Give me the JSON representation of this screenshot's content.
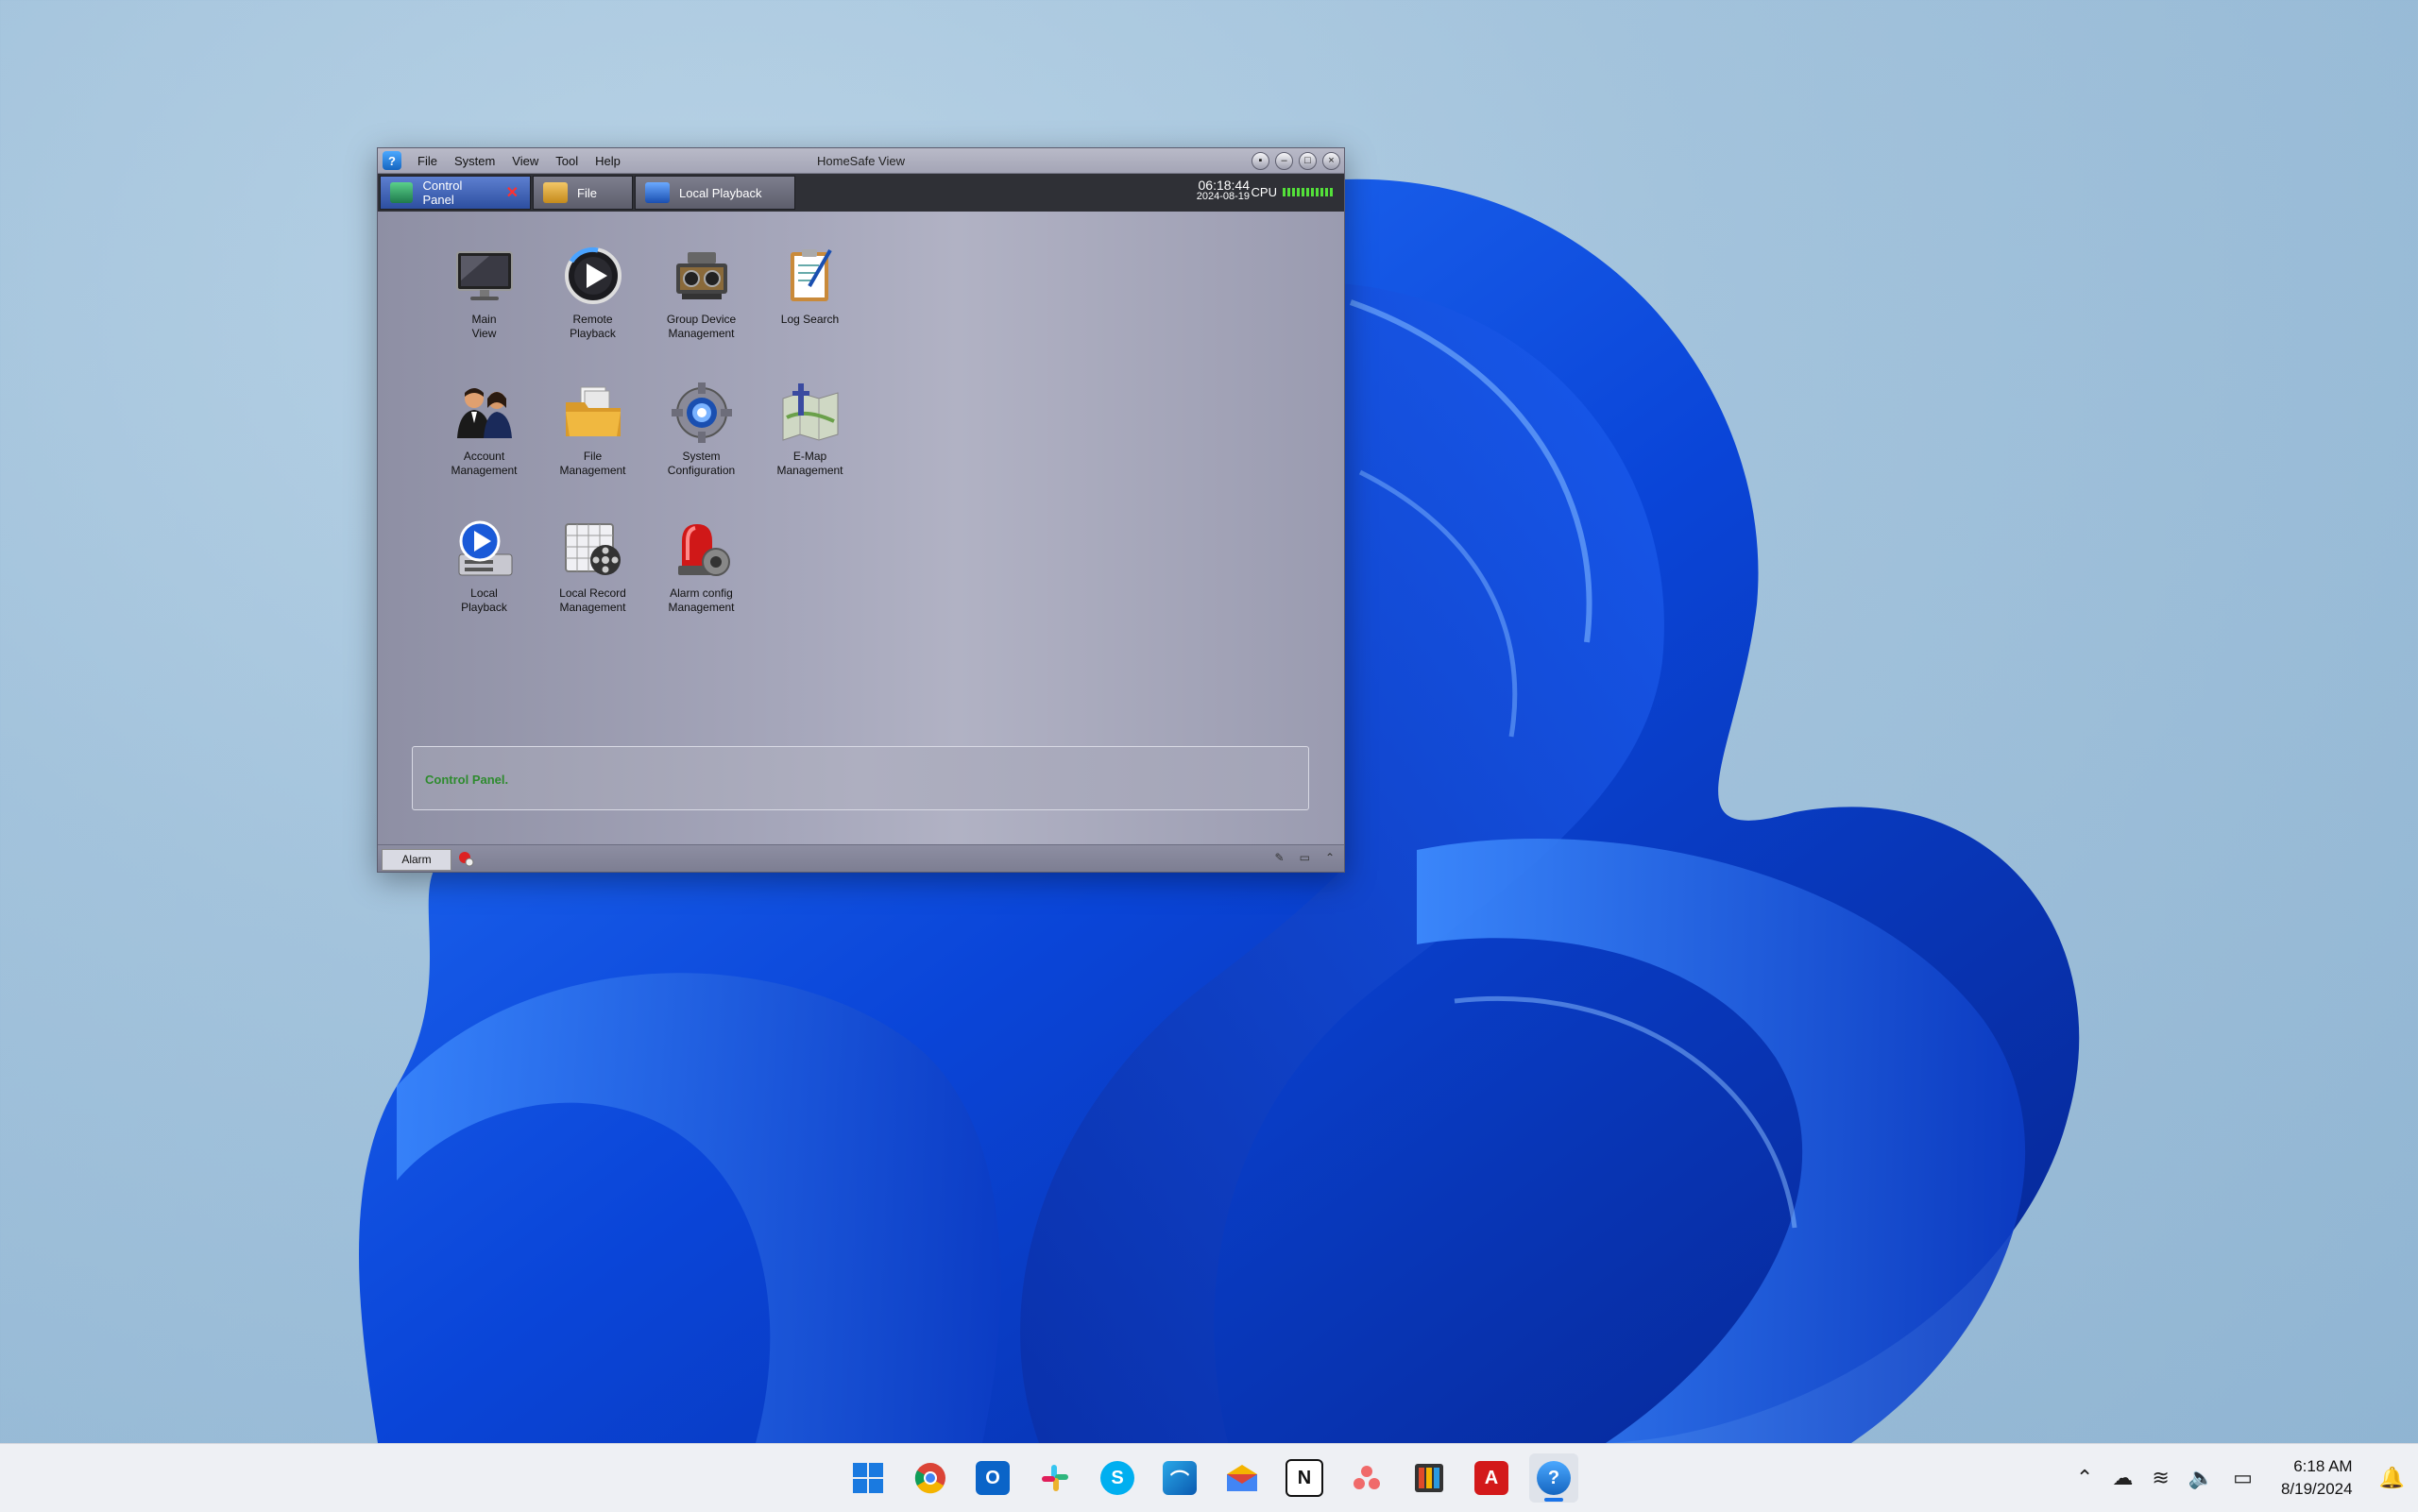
{
  "window": {
    "title": "HomeSafe View",
    "menu": [
      "File",
      "System",
      "View",
      "Tool",
      "Help"
    ],
    "tabs": [
      {
        "label": "Control Panel",
        "active": true
      },
      {
        "label": "File",
        "active": false
      },
      {
        "label": "Local Playback",
        "active": false
      }
    ],
    "clock_time": "06:18:44",
    "clock_date": "2024-08-19",
    "cpu_label": "CPU",
    "cpu_level": 1.0
  },
  "control_panel": {
    "items": [
      {
        "label": "Main\nView",
        "icon": "monitor-icon"
      },
      {
        "label": "Remote\nPlayback",
        "icon": "remote-playback-icon"
      },
      {
        "label": "Group Device\nManagement",
        "icon": "device-icon"
      },
      {
        "label": "Log Search",
        "icon": "log-icon"
      },
      {
        "label": "Account\nManagement",
        "icon": "account-icon"
      },
      {
        "label": "File\nManagement",
        "icon": "folder-icon"
      },
      {
        "label": "System\nConfiguration",
        "icon": "gear-icon"
      },
      {
        "label": "E-Map\nManagement",
        "icon": "map-icon"
      },
      {
        "label": "Local\nPlayback",
        "icon": "local-playback-icon"
      },
      {
        "label": "Local Record\nManagement",
        "icon": "record-icon"
      },
      {
        "label": "Alarm config\nManagement",
        "icon": "alarm-config-icon"
      }
    ],
    "status_text": "Control Panel."
  },
  "bottom_bar": {
    "alarm_tab": "Alarm"
  },
  "taskbar": {
    "apps": [
      "start-icon",
      "chrome-icon",
      "outlook-icon",
      "slack-icon",
      "skype-icon",
      "app-icon",
      "mail-icon",
      "notion-icon",
      "asana-icon",
      "app2-icon",
      "acrobat-icon",
      "homesafe-icon"
    ],
    "time": "6:18 AM",
    "date": "8/19/2024"
  }
}
